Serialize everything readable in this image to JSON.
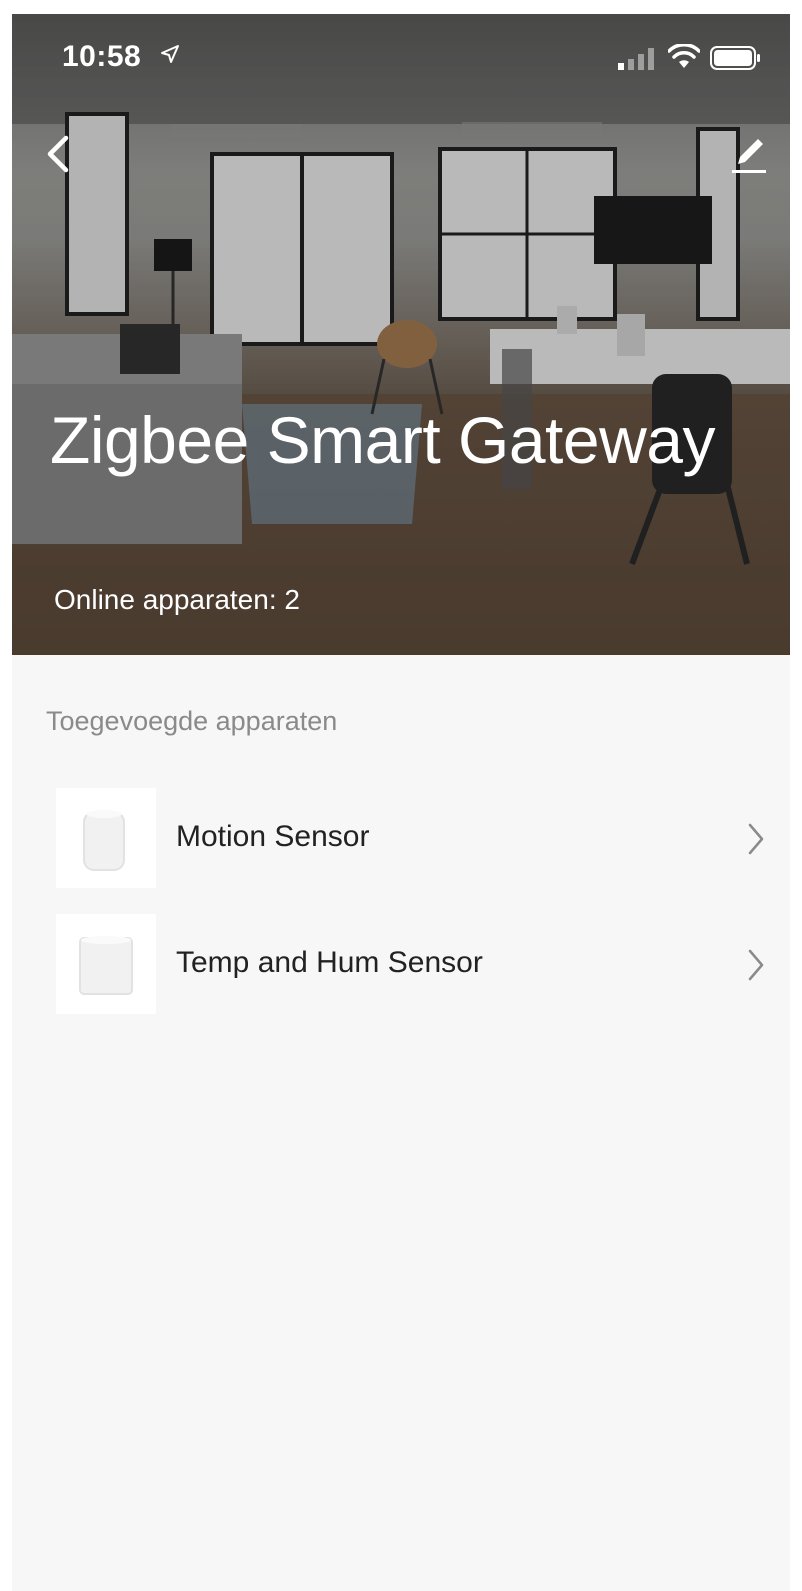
{
  "status_bar": {
    "time": "10:58",
    "icons": [
      "location-arrow-icon",
      "cellular-signal-icon",
      "wifi-icon",
      "battery-icon"
    ]
  },
  "header": {
    "back_icon": "chevron-left-icon",
    "edit_icon": "pencil-icon",
    "title": "Zigbee Smart Gateway",
    "online_devices": "Online apparaten: 2"
  },
  "main": {
    "section_heading": "Toegevoegde apparaten",
    "devices": [
      {
        "name": "Motion Sensor",
        "icon": "motion-sensor-icon"
      },
      {
        "name": "Temp and Hum Sensor",
        "icon": "temp-hum-sensor-icon"
      }
    ]
  },
  "colors": {
    "background": "#f7f7f7",
    "text_primary": "#222222",
    "text_secondary": "#8a8a8a",
    "hero_text": "#ffffff"
  }
}
